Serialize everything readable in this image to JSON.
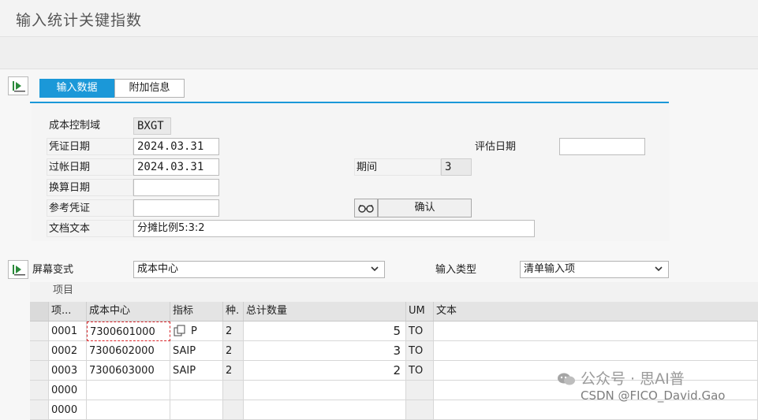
{
  "window": {
    "title": "输入统计关键指数"
  },
  "tabs": {
    "input_data": "输入数据",
    "additional_info": "附加信息"
  },
  "header": {
    "cost_area_label": "成本控制域",
    "cost_area_value": "BXGT",
    "doc_date_label": "凭证日期",
    "doc_date_value": "2024.03.31",
    "posting_date_label": "过帐日期",
    "posting_date_value": "2024.03.31",
    "translation_date_label": "换算日期",
    "translation_date_value": "",
    "ref_doc_label": "参考凭证",
    "ref_doc_value": "",
    "doc_text_label": "文档文本",
    "doc_text_value": "分摊比例5:3:2",
    "valuation_date_label": "评估日期",
    "valuation_date_value": "",
    "period_label": "期间",
    "period_value": "3",
    "confirm_label": "确认"
  },
  "screen": {
    "variant_label": "屏幕变式",
    "variant_value": "成本中心",
    "input_type_label": "输入类型",
    "input_type_value": "清单输入项"
  },
  "grid": {
    "section_label": "项目",
    "columns": [
      "项...",
      "成本中心",
      "指标",
      "种.",
      "总计数量",
      "UM",
      "文本"
    ],
    "rows": [
      {
        "item": "0001",
        "cost_center": "7300601000",
        "indicator": "P",
        "type": "2",
        "qty": "5",
        "um": "TO",
        "text": ""
      },
      {
        "item": "0002",
        "cost_center": "7300602000",
        "indicator": "SAIP",
        "type": "2",
        "qty": "3",
        "um": "TO",
        "text": ""
      },
      {
        "item": "0003",
        "cost_center": "7300603000",
        "indicator": "SAIP",
        "type": "2",
        "qty": "2",
        "um": "TO",
        "text": ""
      },
      {
        "item": "0000",
        "cost_center": "",
        "indicator": "",
        "type": "",
        "qty": "",
        "um": "",
        "text": ""
      },
      {
        "item": "0000",
        "cost_center": "",
        "indicator": "",
        "type": "",
        "qty": "",
        "um": "",
        "text": ""
      }
    ]
  },
  "watermark": {
    "line1": "公众号 · 思AI普",
    "line2": "CSDN @FICO_David.Gao"
  },
  "colors": {
    "accent": "#1b98d8",
    "selection": "#d9262b"
  }
}
